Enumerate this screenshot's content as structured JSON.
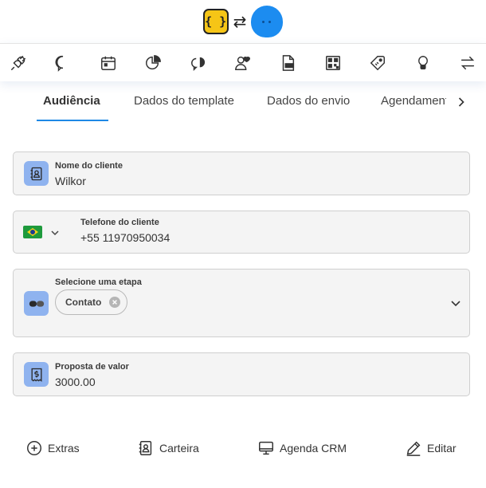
{
  "header": {
    "left_logo": "bracket-logo-icon",
    "swap": "⇄",
    "right_logo": "blue-mascot-icon",
    "logo_text": "{ }"
  },
  "toolbar": [
    {
      "name": "plug-icon"
    },
    {
      "name": "chat-bubble-icon"
    },
    {
      "name": "calendar-icon"
    },
    {
      "name": "pie-chart-icon"
    },
    {
      "name": "messages-icon"
    },
    {
      "name": "users-heart-icon"
    },
    {
      "name": "document-icon"
    },
    {
      "name": "qr-code-icon"
    },
    {
      "name": "tag-icon"
    },
    {
      "name": "lightbulb-icon"
    },
    {
      "name": "transfer-icon"
    }
  ],
  "tabs": [
    "Audiência",
    "Dados do template",
    "Dados do envio",
    "Agendamento"
  ],
  "form": {
    "name_label": "Nome do cliente",
    "name_value": "Wilkor",
    "phone_label": "Telefone do cliente",
    "phone_value": "+55 11970950034",
    "stage_label": "Selecione uma etapa",
    "stage_chip": "Contato",
    "proposal_label": "Proposta de valor",
    "proposal_value": "3000.00"
  },
  "actions": {
    "extras": "Extras",
    "wallet": "Carteira",
    "agenda": "Agenda CRM",
    "edit": "Editar"
  },
  "colors": {
    "accent": "#1e88e5",
    "icon_bg": "#8fb3ef",
    "field_bg": "#f4f4f4"
  }
}
